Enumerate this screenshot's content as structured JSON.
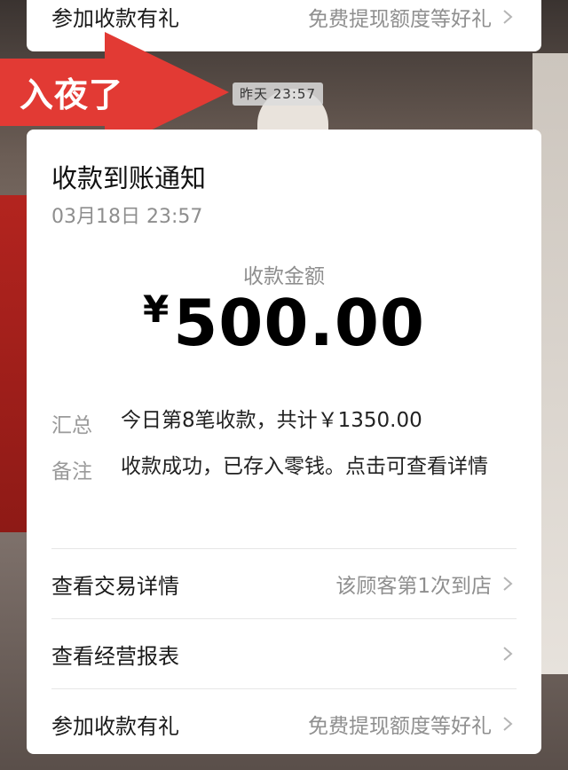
{
  "top_row": {
    "label": "参加收款有礼",
    "value": "免费提现额度等好礼"
  },
  "overlay": {
    "arrow_text": "入夜了",
    "time_badge": "昨天 23:57"
  },
  "notice": {
    "title": "收款到账通知",
    "date": "03月18日 23:57",
    "amount_label": "收款金额",
    "currency_symbol": "¥",
    "amount": "500.00",
    "summary_key": "汇总",
    "summary_value": "今日第8笔收款，共计￥1350.00",
    "note_key": "备注",
    "note_value": "收款成功，已存入零钱。点击可查看详情"
  },
  "rows": [
    {
      "label": "查看交易详情",
      "value": "该顾客第1次到店"
    },
    {
      "label": "查看经营报表",
      "value": ""
    },
    {
      "label": "参加收款有礼",
      "value": "免费提现额度等好礼"
    }
  ],
  "colors": {
    "accent_red": "#e23a34",
    "card_bg": "#ffffff",
    "muted_text": "#8e8e8e"
  }
}
